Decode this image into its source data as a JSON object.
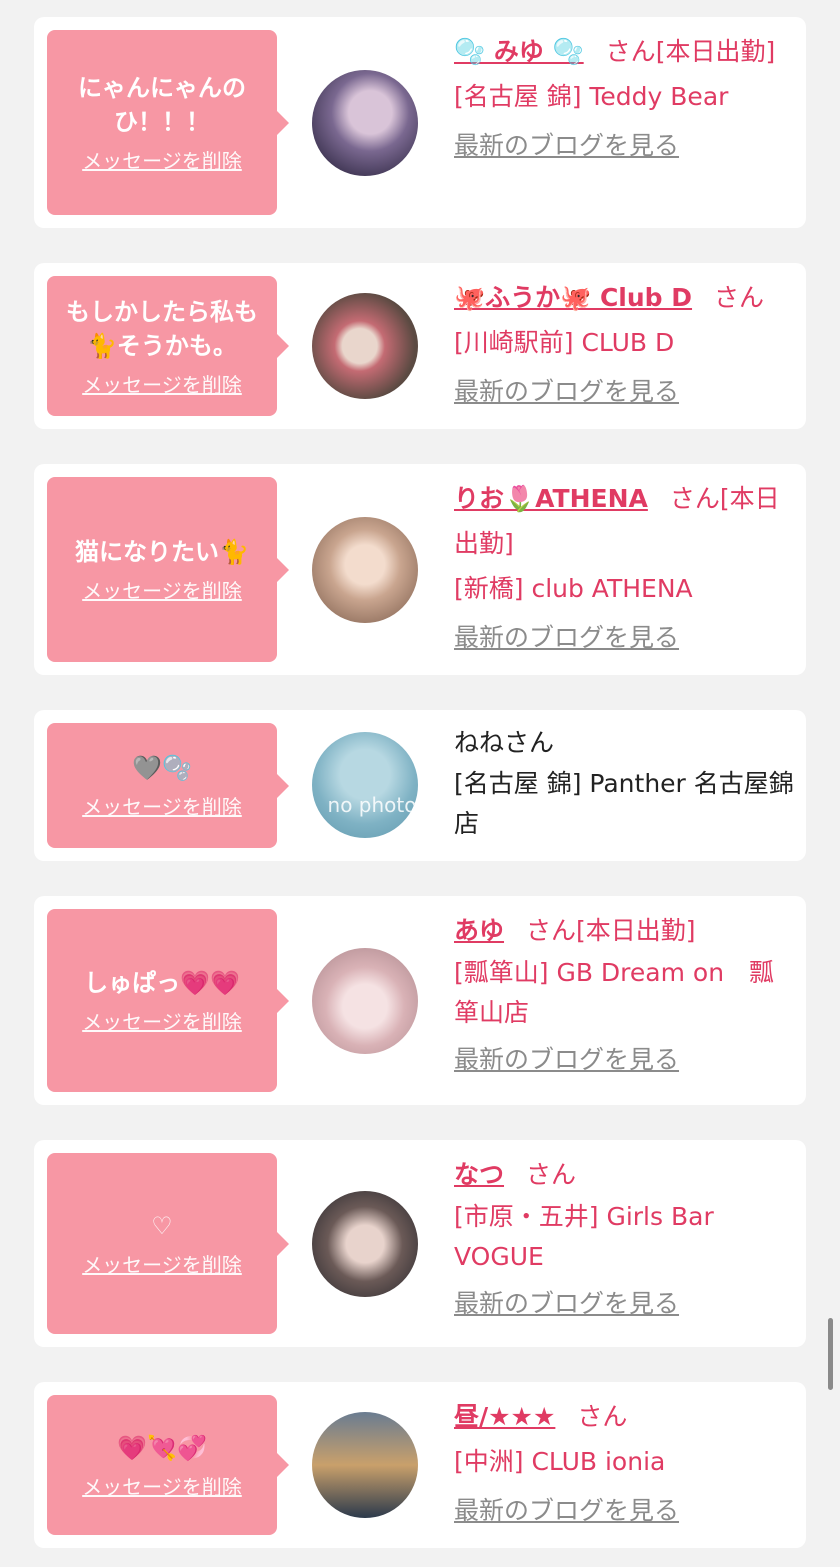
{
  "delete_label": "メッセージを削除",
  "blog_label": "最新のブログを見る",
  "san_label": "さん",
  "entries": [
    {
      "message": "にゃんにゃんのひ！！！",
      "name": "🫧 みゆ 🫧",
      "badge": "[本日出勤]",
      "shop": "[名古屋 錦] Teddy Bear",
      "avatar_colors": [
        "#3c3350",
        "#d9c4d8",
        "#7a6890"
      ]
    },
    {
      "message": "もしかしたら私も🐈そうかも。",
      "name": "🐙ふうか🐙 Club D",
      "badge": "",
      "shop": "[川崎駅前] CLUB D",
      "avatar_colors": [
        "#5b4a42",
        "#e9d6cc",
        "#c46b73"
      ]
    },
    {
      "message": "猫になりたい🐈",
      "name": "りお🌷ATHENA",
      "badge": "[本日出勤]",
      "shop": "[新橋] club ATHENA",
      "avatar_colors": [
        "#c9a58f",
        "#f3dccd",
        "#8d6d5b"
      ]
    },
    {
      "message": "🩶🫧",
      "name": "ねね",
      "badge": "",
      "shop": "[名古屋 錦] Panther 名古屋錦店",
      "avatar_text": "no photo",
      "avatar_colors": [
        "#7fb2c4",
        "#b7d8e2",
        "#5f98ad"
      ]
    },
    {
      "message": "しゅぱっ💗💗",
      "name": "あゆ",
      "badge": "[本日出勤]",
      "shop": "[瓢箪山] GB Dream on　瓢箪山店",
      "avatar_colors": [
        "#d9b2b6",
        "#f5e2e3",
        "#b38e93"
      ]
    },
    {
      "message": "♡",
      "name": "なつ",
      "badge": "",
      "shop": "[市原・五井] Girls Bar VOGUE",
      "avatar_colors": [
        "#3a3538",
        "#e8d3cc",
        "#6b5a57"
      ]
    },
    {
      "message": "💗💘💞",
      "name": "昼/★★★",
      "badge": "",
      "shop": "[中洲] CLUB ionia",
      "avatar_colors": [
        "#2c3a4c",
        "#c9a06b",
        "#6a7c91"
      ]
    }
  ]
}
